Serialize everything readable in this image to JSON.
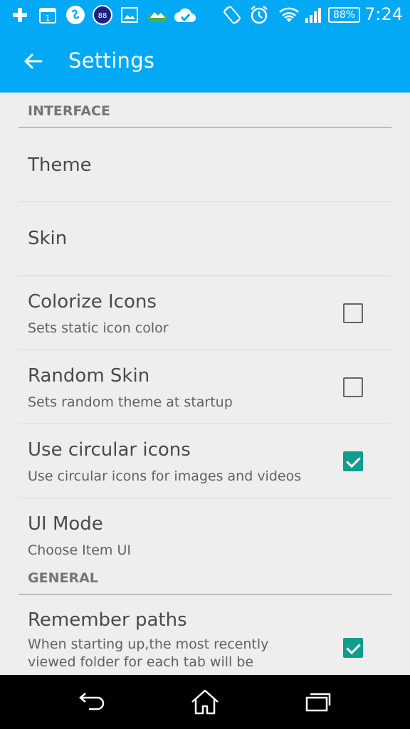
{
  "status_bar": {
    "battery": "88%",
    "time": "7:24",
    "calendar_day": "1",
    "badge_count": "88"
  },
  "app_bar": {
    "title": "Settings"
  },
  "sections": [
    {
      "header": "INTERFACE",
      "items": [
        {
          "title": "Theme",
          "summary": "",
          "checkbox": null
        },
        {
          "title": "Skin",
          "summary": "",
          "checkbox": null
        },
        {
          "title": "Colorize Icons",
          "summary": "Sets static icon color",
          "checkbox": false
        },
        {
          "title": "Random Skin",
          "summary": "Sets random theme at startup",
          "checkbox": false
        },
        {
          "title": "Use circular icons",
          "summary": "Use circular icons for images and videos",
          "checkbox": true
        },
        {
          "title": "UI Mode",
          "summary": "Choose Item UI",
          "checkbox": null
        }
      ]
    },
    {
      "header": "GENERAL",
      "items": [
        {
          "title": "Remember paths",
          "summary_lines": [
            "When starting up,the most recently",
            "viewed folder for each tab will be"
          ],
          "checkbox": true
        }
      ]
    }
  ],
  "colors": {
    "primary": "#03a9f4",
    "accent": "#0f9d8e",
    "background": "#eeeeee"
  }
}
